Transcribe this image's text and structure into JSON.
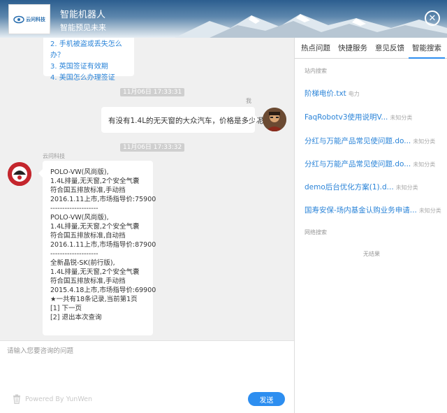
{
  "header": {
    "title": "智能机器人",
    "subtitle": "智能预见未来",
    "logo_text": "云问科技"
  },
  "chat": {
    "top_card_items": [
      {
        "label": "2.  手机被盗或丢失怎么办？"
      },
      {
        "label": "3.  英国签证有效期"
      },
      {
        "label": "4.  美国怎么办理签证"
      }
    ],
    "timestamp_1": "11月06日 17:33:31",
    "user_name": "我",
    "user_message": "有没有1.4L的无天窗的大众汽车，价格是多少呢",
    "timestamp_2": "11月06日 17:33:32",
    "bot_name": "云问科技",
    "bot_lines": [
      "POLO-VW(风尚版),",
      "1.4L排量,无天窗,2个安全气囊",
      "符合国五排放标准,手动挡",
      "2016.1.11上市,市场指导价:75900",
      "--------------------",
      "POLO-VW(风尚版),",
      "1.4L排量,无天窗,2个安全气囊",
      "符合国五排放标准,自动挡",
      "2016.1.11上市,市场指导价:87900",
      "--------------------",
      "全新晶锐-SK(前行版),",
      "1.4L排量,无天窗,2个安全气囊",
      "符合国五排放标准,手动挡",
      "2015.4.18上市,市场指导价:69900",
      "★一共有18条记录,当前第1页",
      "[1] 下一页",
      "[2] 退出本次查询"
    ]
  },
  "input": {
    "placeholder": "请输入您要咨询的问题",
    "powered_by": "Powered By YunWen",
    "send_label": "发送"
  },
  "right_panel": {
    "tabs": [
      {
        "label": "热点问题",
        "active": false
      },
      {
        "label": "快捷服务",
        "active": false
      },
      {
        "label": "意见反馈",
        "active": false
      },
      {
        "label": "智能搜索",
        "active": true
      }
    ],
    "site_search_label": "站内搜索",
    "results": [
      {
        "title": "阶梯电价.txt",
        "category": "电力"
      },
      {
        "title": "FaqRobotv3使用说明V...",
        "category": "未知分类"
      },
      {
        "title": "分红与万能产品常见使问题.do...",
        "category": "未知分类"
      },
      {
        "title": "分红与万能产品常见使问题.do...",
        "category": "未知分类"
      },
      {
        "title": "demo后台优化方案(1).d...",
        "category": "未知分类"
      },
      {
        "title": "国寿安保-场内基金认购业务申请...",
        "category": "未知分类"
      }
    ],
    "web_search_label": "网络搜索",
    "no_result": "无结果"
  },
  "colors": {
    "accent": "#2d8ef0",
    "link": "#2b84d8",
    "chat_bg": "#f0f0f0",
    "bot_avatar": "#c4262d"
  },
  "icons": {
    "close": "close-icon",
    "trash": "trash-icon",
    "logo": "cloud-logo-icon"
  }
}
